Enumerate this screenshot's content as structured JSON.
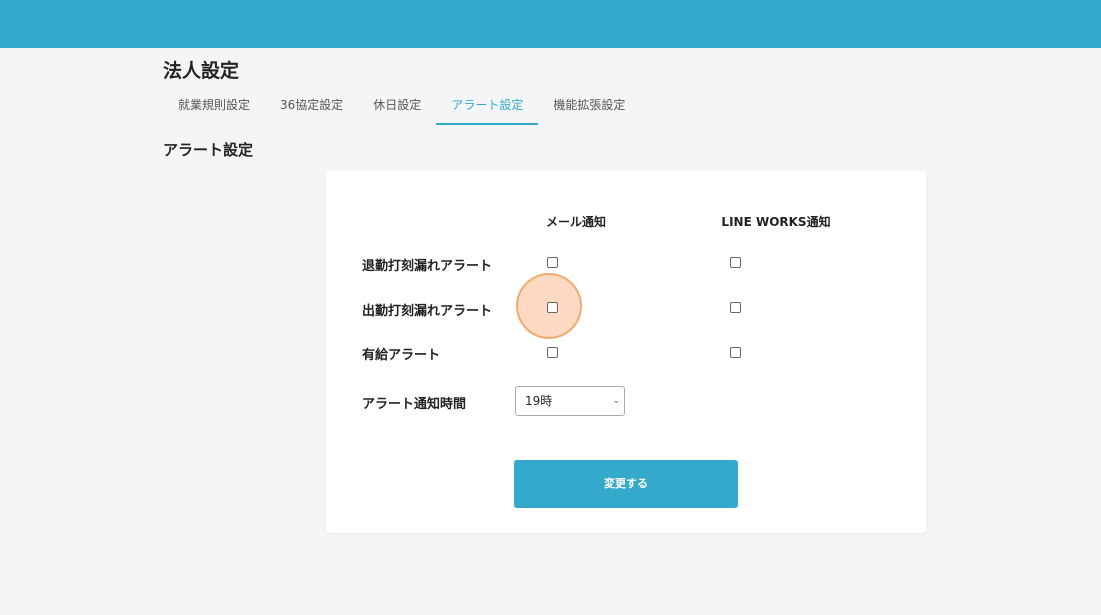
{
  "colors": {
    "accent": "#33a9cc",
    "background": "#f4f5f7",
    "card": "#ffffff",
    "highlight": "#ffaa78"
  },
  "page": {
    "title": "法人設定"
  },
  "tabs": [
    {
      "label": "就業規則設定",
      "active": false
    },
    {
      "label": "36協定設定",
      "active": false
    },
    {
      "label": "休日設定",
      "active": false
    },
    {
      "label": "アラート設定",
      "active": true
    },
    {
      "label": "機能拡張設定",
      "active": false
    }
  ],
  "section": {
    "title": "アラート設定"
  },
  "alert_table": {
    "columns": [
      "メール通知",
      "LINE WORKS通知"
    ],
    "rows": [
      {
        "label": "退勤打刻漏れアラート",
        "mail": false,
        "line_works": false
      },
      {
        "label": "出勤打刻漏れアラート",
        "mail": false,
        "line_works": false
      },
      {
        "label": "有給アラート",
        "mail": false,
        "line_works": false
      }
    ]
  },
  "notify_time": {
    "label": "アラート通知時間",
    "value": "19時"
  },
  "submit": {
    "label": "変更する"
  }
}
